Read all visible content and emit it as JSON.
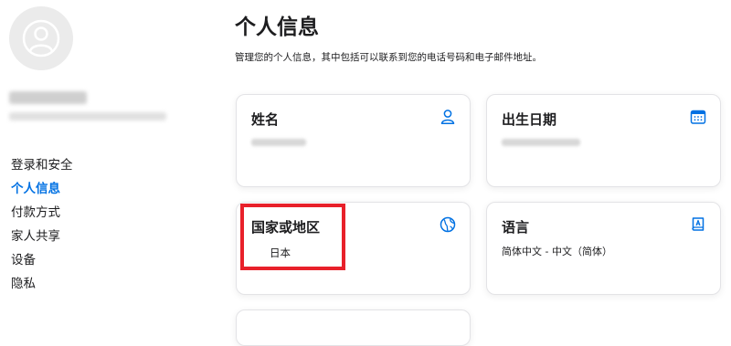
{
  "page": {
    "title": "个人信息",
    "subtitle": "管理您的个人信息，其中包括可以联系到您的电话号码和电子邮件地址。"
  },
  "sidebar": {
    "nav": [
      {
        "label": "登录和安全",
        "active": false
      },
      {
        "label": "个人信息",
        "active": true
      },
      {
        "label": "付款方式",
        "active": false
      },
      {
        "label": "家人共享",
        "active": false
      },
      {
        "label": "设备",
        "active": false
      },
      {
        "label": "隐私",
        "active": false
      }
    ]
  },
  "cards": {
    "name": {
      "title": "姓名",
      "icon": "person-icon"
    },
    "birthday": {
      "title": "出生日期",
      "icon": "calendar-icon"
    },
    "country": {
      "title": "国家或地区",
      "value": "日本",
      "icon": "globe-icon"
    },
    "language": {
      "title": "语言",
      "value": "简体中文 - 中文（简体）",
      "icon": "language-book-icon"
    }
  },
  "colors": {
    "accent": "#0071e3",
    "highlight": "#e8202a",
    "card_border": "#e3e3e6"
  }
}
